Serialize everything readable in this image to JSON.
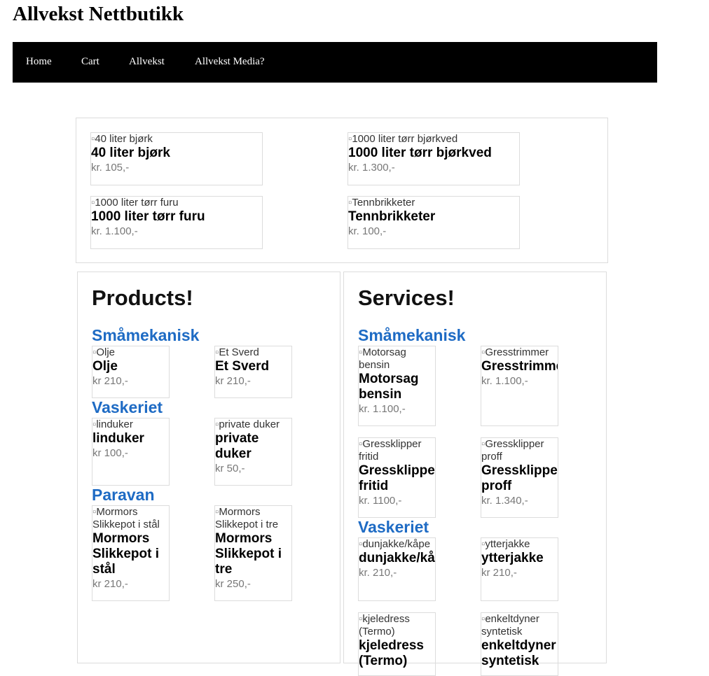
{
  "site": {
    "title": "Allvekst Nettbutikk"
  },
  "nav": [
    "Home",
    "Cart",
    "Allvekst",
    "Allvekst Media?"
  ],
  "featured": [
    {
      "alt": "40 liter bjørk",
      "name": "40 liter bjørk",
      "price": "kr. 105,-"
    },
    {
      "alt": "1000 liter tørr bjørkved",
      "name": "1000 liter tørr bjørkved",
      "price": "kr. 1.300,-"
    },
    {
      "alt": "1000 liter tørr furu",
      "name": "1000 liter tørr furu",
      "price": "kr. 1.100,-"
    },
    {
      "alt": "Tennbrikketer",
      "name": "Tennbrikketer",
      "price": "kr. 100,-"
    }
  ],
  "products": {
    "title": "Products!",
    "categories": [
      {
        "name": "Småmekanisk",
        "items": [
          {
            "alt": "Olje",
            "name": "Olje",
            "price": "kr 210,-"
          },
          {
            "alt": "Et Sverd",
            "name": "Et Sverd",
            "price": "kr 210,-"
          }
        ]
      },
      {
        "name": "Vaskeriet",
        "items": [
          {
            "alt": "linduker",
            "name": "linduker",
            "price": "kr 100,-"
          },
          {
            "alt": "private duker",
            "name": "private duker",
            "price": "kr 50,-"
          }
        ]
      },
      {
        "name": "Paravan",
        "items": [
          {
            "alt": "Mormors Slikkepot i stål",
            "name": "Mormors Slikkepot i stål",
            "price": "kr 210,-"
          },
          {
            "alt": "Mormors Slikkepot i tre",
            "name": "Mormors Slikkepot i tre",
            "price": "kr 250,-"
          }
        ]
      }
    ]
  },
  "services": {
    "title": "Services!",
    "categories": [
      {
        "name": "Småmekanisk",
        "items": [
          {
            "alt": "Motorsag bensin",
            "name": "Motorsag bensin",
            "price": "kr. 1.100,-"
          },
          {
            "alt": "Gresstrimmer",
            "name": "Gresstrimmer",
            "price": "kr. 1.100,-"
          },
          {
            "alt": "Gressklipper fritid",
            "name": "Gressklipper fritid",
            "price": "kr. 1100,-"
          },
          {
            "alt": "Gressklipper proff",
            "name": "Gressklipper proff",
            "price": "kr. 1.340,-"
          }
        ]
      },
      {
        "name": "Vaskeriet",
        "items": [
          {
            "alt": "dunjakke/kåpe",
            "name": "dunjakke/kåpe",
            "price": "kr. 210,-"
          },
          {
            "alt": "ytterjakke",
            "name": "ytterjakke",
            "price": "kr 210,-"
          },
          {
            "alt": "kjeledress (Termo)",
            "name": "kjeledress (Termo)",
            "price": ""
          },
          {
            "alt": "enkeltdyner syntetisk",
            "name": "enkeltdyner syntetisk",
            "price": ""
          }
        ]
      }
    ]
  }
}
